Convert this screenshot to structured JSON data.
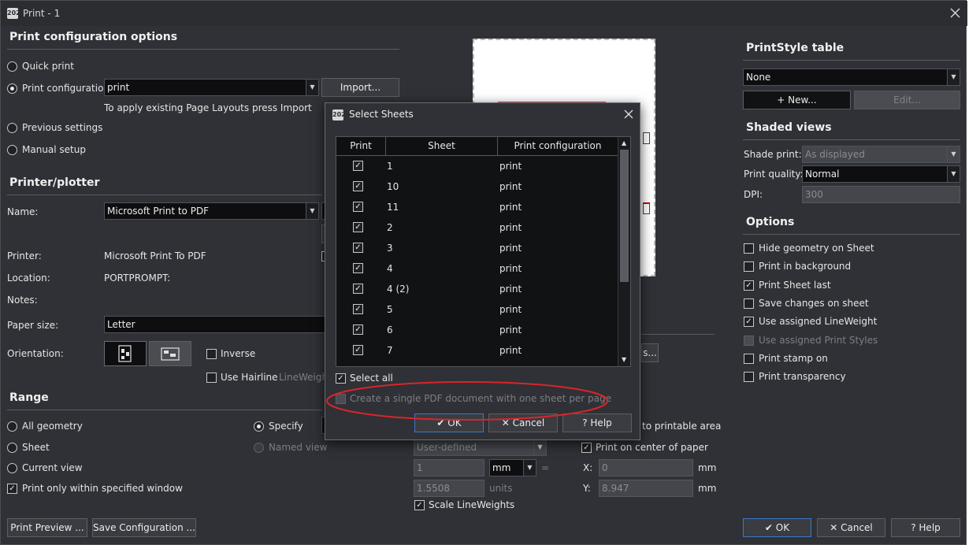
{
  "window": {
    "title": "Print - 1",
    "app_icon": "bricscad-2024-icon",
    "app_icon_text": "2024"
  },
  "config_section": {
    "heading": "Print configuration options",
    "quick_print": "Quick print",
    "print_configuration": "Print configuration:",
    "config_value": "print",
    "import_button": "Import...",
    "hint": "To apply existing Page Layouts press Import",
    "previous_settings": "Previous settings",
    "manual_setup": "Manual setup",
    "selected": "print_configuration"
  },
  "printer_section": {
    "heading": "Printer/plotter",
    "name_label": "Name:",
    "name_value": "Microsoft Print to PDF",
    "printer_label": "Printer:",
    "printer_value": "Microsoft Print To PDF",
    "location_label": "Location:",
    "location_value": "PORTPROMPT:",
    "notes_label": "Notes:",
    "paper_label": "Paper size:",
    "paper_value": "Letter",
    "orientation_label": "Orientation:",
    "inverse": "Inverse",
    "use_hairline": "Use Hairline",
    "lineweight": "LineWeight"
  },
  "range_section": {
    "heading": "Range",
    "all_geometry": "All geometry",
    "sheet": "Sheet",
    "current_view": "Current view",
    "print_only_window": "Print only within specified window",
    "specify": "Specify",
    "named_view": "Named view"
  },
  "scale_section": {
    "printable_area": "to printable area",
    "user_defined": "User-defined",
    "print_center": "Print on center of paper",
    "scale_num": "1",
    "scale_unit": "mm",
    "equals": "=",
    "scale_den": "1.5508",
    "units": "units",
    "scale_lineweights": "Scale LineWeights",
    "x_label": "X:",
    "x_value": "0",
    "x_unit": "mm",
    "y_label": "Y:",
    "y_value": "8.947",
    "y_unit": "mm",
    "partial_button": "s..."
  },
  "printstyle": {
    "heading": "PrintStyle table",
    "value": "None",
    "new_button": "New...",
    "edit_button": "Edit..."
  },
  "shaded": {
    "heading": "Shaded views",
    "shade_label": "Shade print:",
    "shade_value": "As displayed",
    "quality_label": "Print quality:",
    "quality_value": "Normal",
    "dpi_label": "DPI:",
    "dpi_value": "300"
  },
  "options": {
    "heading": "Options",
    "items": [
      {
        "label": "Hide geometry on Sheet",
        "checked": false,
        "enabled": true
      },
      {
        "label": "Print in background",
        "checked": false,
        "enabled": true
      },
      {
        "label": "Print Sheet last",
        "checked": true,
        "enabled": true
      },
      {
        "label": "Save changes on sheet",
        "checked": false,
        "enabled": true
      },
      {
        "label": "Use assigned LineWeight",
        "checked": true,
        "enabled": true
      },
      {
        "label": "Use assigned Print Styles",
        "checked": false,
        "enabled": false
      },
      {
        "label": "Print stamp on",
        "checked": false,
        "enabled": true
      },
      {
        "label": "Print transparency",
        "checked": false,
        "enabled": true
      }
    ]
  },
  "footer": {
    "preview_button": "Print Preview ...",
    "save_config_button": "Save Configuration ...",
    "ok": "OK",
    "cancel": "Cancel",
    "help": "Help"
  },
  "select_sheets": {
    "title": "Select Sheets",
    "col_print": "Print",
    "col_sheet": "Sheet",
    "col_config": "Print configuration",
    "rows": [
      {
        "sheet": "1",
        "config": "print",
        "checked": true
      },
      {
        "sheet": "10",
        "config": "print",
        "checked": true
      },
      {
        "sheet": "11",
        "config": "print",
        "checked": true
      },
      {
        "sheet": "2",
        "config": "print",
        "checked": true
      },
      {
        "sheet": "3",
        "config": "print",
        "checked": true
      },
      {
        "sheet": "4",
        "config": "print",
        "checked": true
      },
      {
        "sheet": "4 (2)",
        "config": "print",
        "checked": true
      },
      {
        "sheet": "5",
        "config": "print",
        "checked": true
      },
      {
        "sheet": "6",
        "config": "print",
        "checked": true
      },
      {
        "sheet": "7",
        "config": "print",
        "checked": true
      }
    ],
    "select_all": "Select all",
    "single_pdf": "Create a single PDF document with one sheet per page",
    "ok": "OK",
    "cancel": "Cancel",
    "help": "Help"
  },
  "colors": {
    "annotation_circle": "#d9252a",
    "focus_border": "#3d78c8"
  }
}
